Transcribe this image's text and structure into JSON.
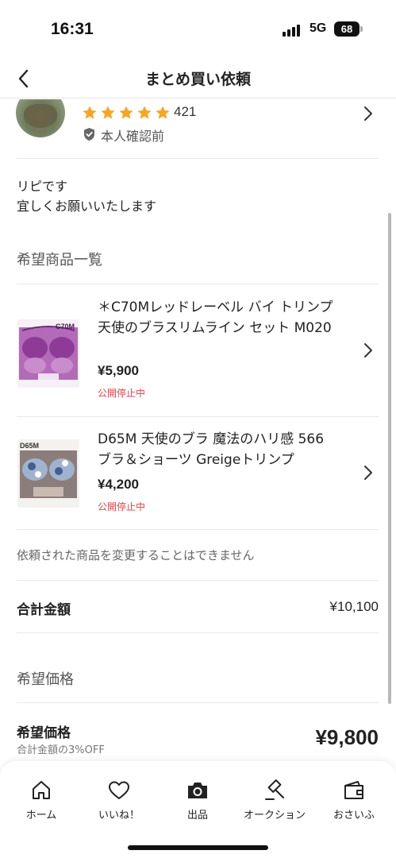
{
  "status_bar": {
    "time": "16:31",
    "network": "5G",
    "battery": "68"
  },
  "nav": {
    "title": "まとめ買い依頼",
    "back_icon": "chevron-left-icon"
  },
  "seller": {
    "rating_stars": 5,
    "rating_count": "421",
    "verification": "本人確認前",
    "star_color": "#f5a623"
  },
  "message": {
    "lines": [
      "リピです",
      "宜しくお願いいたします"
    ]
  },
  "items_section": {
    "title": "希望商品一覧",
    "items": [
      {
        "title": "＊C70Mレッドレーベル バイ トリンプ 天使のブラスリムライン セット M020",
        "price": "¥5,900",
        "status": "公開停止中",
        "thumb_label": "C70M"
      },
      {
        "title": "D65M 天使のブラ 魔法のハリ感 566 ブラ＆ショーツ Greigeトリンプ",
        "price": "¥4,200",
        "status": "公開停止中",
        "thumb_label": "D65M"
      }
    ],
    "note": "依頼された商品を変更することはできません"
  },
  "total": {
    "label": "合計金額",
    "value": "¥10,100"
  },
  "desired_section": {
    "title": "希望価格",
    "label": "希望価格",
    "sub": "合計金額の3%OFF",
    "value": "¥9,800"
  },
  "tab_bar": {
    "tabs": [
      {
        "label": "ホーム",
        "icon": "home-icon"
      },
      {
        "label": "いいね！",
        "icon": "heart-icon"
      },
      {
        "label": "出品",
        "icon": "camera-icon"
      },
      {
        "label": "オークション",
        "icon": "gavel-icon"
      },
      {
        "label": "おさいふ",
        "icon": "wallet-icon"
      }
    ]
  },
  "colors": {
    "accent_red": "#e0424a",
    "star": "#f5a623"
  }
}
